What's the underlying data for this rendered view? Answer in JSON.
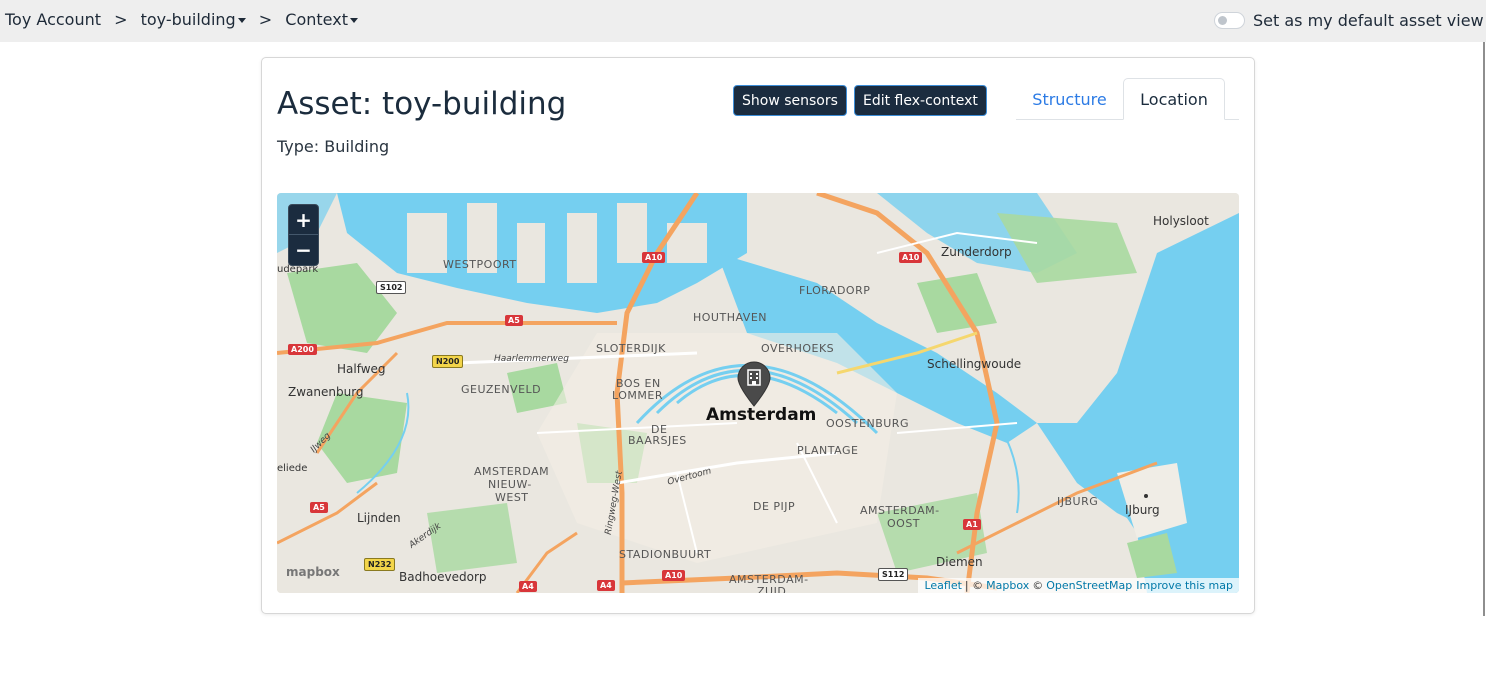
{
  "breadcrumb": {
    "account": "Toy Account",
    "separator": ">",
    "asset": "toy-building",
    "view": "Context"
  },
  "default_view": {
    "label": "Set as my default asset view",
    "checked": false
  },
  "asset": {
    "title": "Asset: toy-building",
    "type": "Type: Building"
  },
  "actions": {
    "show_sensors": "Show sensors",
    "edit_flex_context": "Edit flex-context"
  },
  "tabs": [
    {
      "label": "Structure",
      "active": false
    },
    {
      "label": "Location",
      "active": true
    }
  ],
  "map": {
    "zoom_in": "+",
    "zoom_out": "−",
    "marker_icon": "building-icon",
    "city": "Amsterdam",
    "labels": {
      "westpoort": "WESTPOORT",
      "houthaven": "HOUTHAVEN",
      "floradorp": "FLORADORP",
      "overhoeks": "OVERHOEKS",
      "slotervaart_dijk": "SLOTERDIJK",
      "geuzenveld": "GEUZENVELD",
      "bos_en_lommer_1": "BOS EN",
      "bos_en_lommer_2": "LOMMER",
      "de_baarsjes_1": "DE",
      "de_baarsjes_2": "BAARSJES",
      "oostenburg": "OOSTENBURG",
      "plantage": "PLANTAGE",
      "amsterdam_nieuw_west_1": "AMSTERDAM",
      "amsterdam_nieuw_west_2": "NIEUW-",
      "amsterdam_nieuw_west_3": "WEST",
      "de_pijp": "DE PIJP",
      "amsterdam_oost_1": "AMSTERDAM-",
      "amsterdam_oost_2": "OOST",
      "stadionbuurt": "STADIONBUURT",
      "amsterdam_zuid_1": "AMSTERDAM-",
      "amsterdam_zuid_2": "ZUID",
      "ijburg_caps": "IJBURG",
      "ijburg": "IJburg",
      "holysloot": "Holysloot",
      "zunderdorp": "Zunderdorp",
      "schellingwoude": "Schellingwoude",
      "halfweg": "Halfweg",
      "zwanenburg": "Zwanenburg",
      "lijnden": "Lijnden",
      "badhoevedorp": "Badhoevedorp",
      "diemen": "Diemen",
      "udepark": "udepark",
      "eliede": "eliede",
      "haarlemmerweg": "Haarlemmerweg",
      "overtoom": "Overtoom",
      "ringweg_west": "Ringweg-West",
      "ijweg": "IJweg",
      "akerdijk": "Akerdijk"
    },
    "shields": {
      "s102": "S102",
      "a10_top": "A10",
      "a10_right": "A10",
      "a5_top": "A5",
      "a200": "A200",
      "n200": "N200",
      "a5_bottom": "A5",
      "n232": "N232",
      "a4_left": "A4",
      "a4_right": "A4",
      "a10_bottom": "A10",
      "s112": "S112",
      "a1": "A1"
    },
    "mapbox_logo": "mapbox",
    "attribution": {
      "leaflet": "Leaflet",
      "sep1": "| ©",
      "mapbox": "Mapbox",
      "sep2": "©",
      "osm": "OpenStreetMap",
      "improve": "Improve this map"
    },
    "colors": {
      "water": "#75cff0",
      "land": "#eae7e0",
      "park": "#a8d9a0",
      "motorway": "#f4a460"
    }
  }
}
